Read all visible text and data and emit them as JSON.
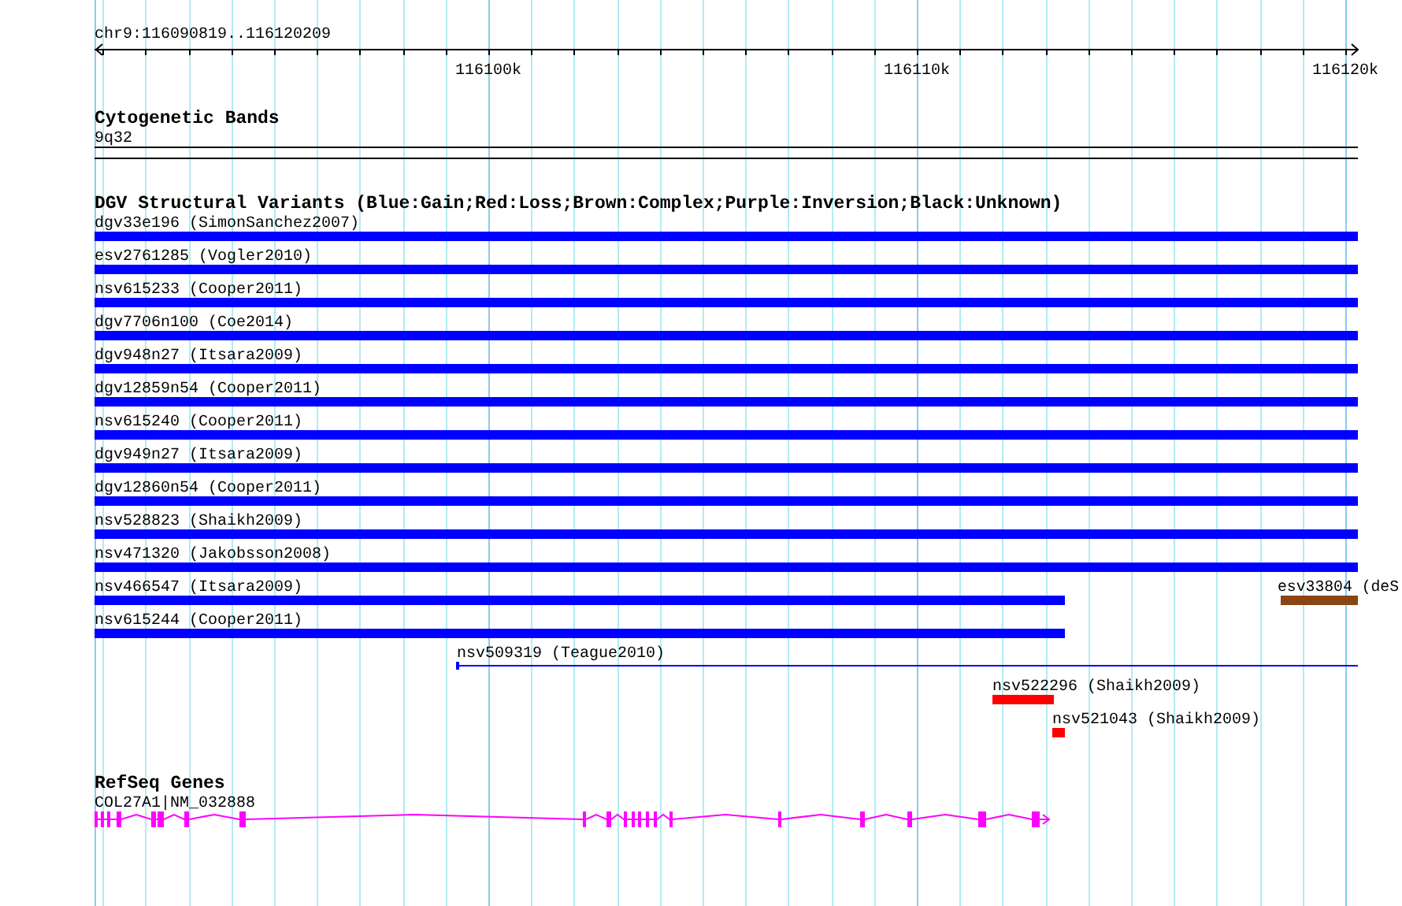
{
  "ruler": {
    "region": "chr9:116090819..116120209",
    "ticks": [
      "116100k",
      "116110k",
      "116120k"
    ]
  },
  "tracks": [
    {
      "kind": "bands",
      "title": "Cytogenetic Bands",
      "features": [
        {
          "label": "9q32"
        }
      ]
    },
    {
      "kind": "variants",
      "title": "DGV Structural Variants (Blue:Gain;Red:Loss;Brown:Complex;Purple:Inversion;Black:Unknown)",
      "features": [
        {
          "label": "dgv33e196 (SimonSanchez2007)",
          "kind": "bar",
          "color": "#0000ff"
        },
        {
          "label": "esv2761285 (Vogler2010)",
          "kind": "bar",
          "color": "#0000ff"
        },
        {
          "label": "nsv615233 (Cooper2011)",
          "kind": "bar",
          "color": "#0000ff"
        },
        {
          "label": "dgv7706n100 (Coe2014)",
          "kind": "bar",
          "color": "#0000ff"
        },
        {
          "label": "dgv948n27 (Itsara2009)",
          "kind": "bar",
          "color": "#0000ff"
        },
        {
          "label": "dgv12859n54 (Cooper2011)",
          "kind": "bar",
          "color": "#0000ff"
        },
        {
          "label": "nsv615240 (Cooper2011)",
          "kind": "bar",
          "color": "#0000ff"
        },
        {
          "label": "dgv949n27 (Itsara2009)",
          "kind": "bar",
          "color": "#0000ff"
        },
        {
          "label": "dgv12860n54 (Cooper2011)",
          "kind": "bar",
          "color": "#0000ff"
        },
        {
          "label": "nsv528823 (Shaikh2009)",
          "kind": "bar",
          "color": "#0000ff"
        },
        {
          "label": "nsv471320 (Jakobsson2008)",
          "kind": "bar",
          "color": "#0000ff"
        },
        {
          "label": "nsv466547 (Itsara2009)",
          "kind": "bar",
          "color": "#0000ff"
        },
        {
          "label": "esv33804 (deS",
          "kind": "bar",
          "color": "#8b4513"
        },
        {
          "label": "nsv615244 (Cooper2011)",
          "kind": "bar",
          "color": "#0000ff"
        },
        {
          "label": "nsv509319 (Teague2010)",
          "kind": "line",
          "color": "#0000ff"
        },
        {
          "label": "nsv522296 (Shaikh2009)",
          "kind": "bar",
          "color": "#ff0000"
        },
        {
          "label": "nsv521043 (Shaikh2009)",
          "kind": "bar",
          "color": "#ff0000"
        }
      ]
    },
    {
      "kind": "gene",
      "title": "RefSeq Genes",
      "features": [
        {
          "label": "COL27A1|NM_032888"
        }
      ]
    }
  ]
}
